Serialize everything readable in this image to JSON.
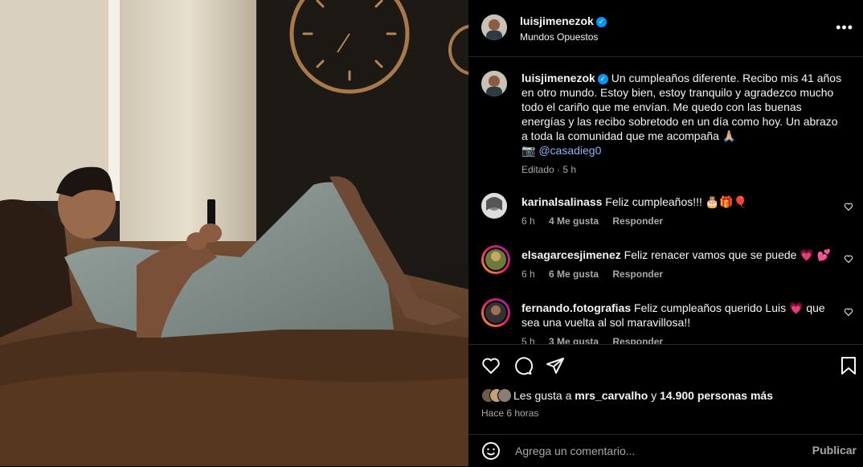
{
  "post": {
    "author": "luisjimenezok",
    "location": "Mundos Opuestos",
    "caption_author": "luisjimenezok",
    "caption_text": "Un cumpleaños diferente. Recibo mis 41 años en otro mundo. Estoy bien, estoy tranquilo y agradezco mucho todo el cariño que me envían. Me quedo con las buenas energías y las recibo sobretodo en un día como hoy. Un abrazo a toda la comunidad que me acompaña 🙏🏼",
    "caption_camera": "📷",
    "caption_credit": "@casadieg0",
    "caption_meta": "Editado · 5 h",
    "more_label": "•••"
  },
  "comments": [
    {
      "user": "karinalsalinass",
      "text": "Feliz cumpleaños!!! 🎂🎁🎈",
      "time": "6 h",
      "likes": "4 Me gusta",
      "reply": "Responder"
    },
    {
      "user": "elsagarcesjimenez",
      "text": "Feliz renacer vamos que se puede 💗 💕",
      "time": "6 h",
      "likes": "6 Me gusta",
      "reply": "Responder"
    },
    {
      "user": "fernando.fotografias",
      "text": "Feliz cumpleaños querido Luis 💗 que sea una vuelta al sol maravillosa!!",
      "time": "5 h",
      "likes": "3 Me gusta",
      "reply": "Responder"
    }
  ],
  "likes": {
    "prefix": "Les gusta a",
    "user": "mrs_carvalho",
    "middle": "y",
    "count": "14.900 personas más"
  },
  "posted_ago": "Hace 6 horas",
  "composer": {
    "placeholder": "Agrega un comentario...",
    "publish": "Publicar"
  },
  "colors": {
    "accent": "#0095f6",
    "link": "#8ab4f8",
    "muted": "#a8a8a8",
    "background": "#000000"
  }
}
